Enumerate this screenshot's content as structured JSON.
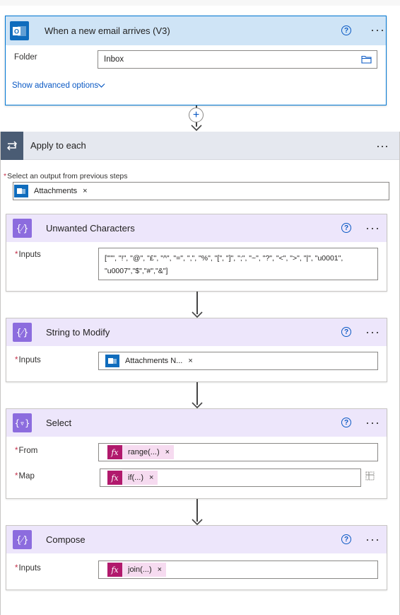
{
  "trigger": {
    "title": "When a new email arrives (V3)",
    "folder_label": "Folder",
    "folder_value": "Inbox",
    "advanced_link": "Show advanced options"
  },
  "apply": {
    "title": "Apply to each",
    "select_label": "Select an output from previous steps",
    "token": "Attachments"
  },
  "unwanted": {
    "title": "Unwanted Characters",
    "inputs_label": "Inputs",
    "value_line1": "[\"\"\", \"!\", \"@\", \"£\", \"^\", \"=\", \",\", \"%\", \"[\", \"]\", \";\", \"~\", \"?\", \"<\", \">\", \"|\", \"u0001\",",
    "value_line2": "\"u0007\",\"$\",\"#\",\"&\"]"
  },
  "string_modify": {
    "title": "String to Modify",
    "inputs_label": "Inputs",
    "token": "Attachments N..."
  },
  "select": {
    "title": "Select",
    "from_label": "From",
    "from_token": "range(...)",
    "map_label": "Map",
    "map_token": "if(...)"
  },
  "compose": {
    "title": "Compose",
    "inputs_label": "Inputs",
    "token": "join(...)"
  },
  "icons": {
    "trigger": "outlook-icon",
    "loop": "loop-icon",
    "data_op": "curly-braces-icon",
    "select": "filter-braces-icon",
    "help": "help-circle-icon",
    "more": "more-dots-icon",
    "folder": "folder-icon",
    "chevron": "chevron-down-icon",
    "expression": "fx-icon",
    "map_toggle": "table-toggle-icon"
  },
  "colors": {
    "trigger_header": "#cfe4f6",
    "action_header": "#ede6fb",
    "loop_header": "#e5e8ef",
    "accent": "#0078d4",
    "expression": "#b1196c"
  }
}
